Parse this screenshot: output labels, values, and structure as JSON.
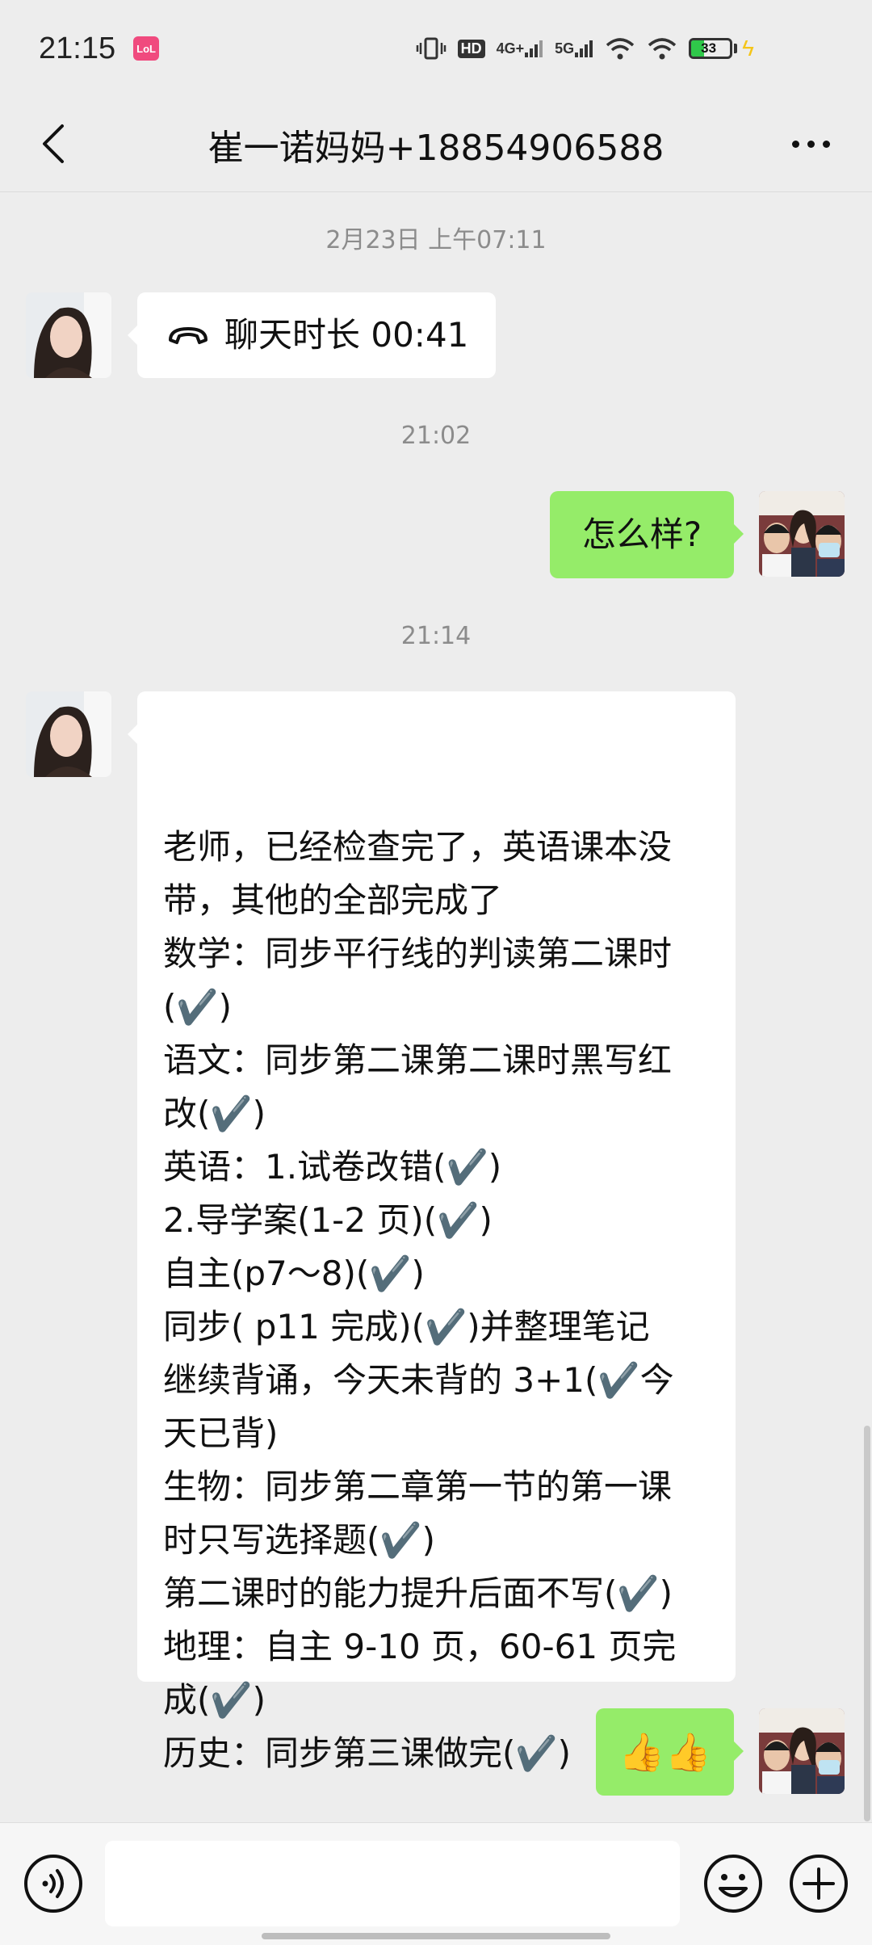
{
  "status_bar": {
    "time": "21:15",
    "app_badge": "LoL",
    "hd_label": "HD",
    "net1_label": "4G+",
    "net2_label": "5G",
    "battery": "33",
    "battery_level": 0.33,
    "icons": [
      "vibrate-icon",
      "hd-icon",
      "signal-4g-icon",
      "signal-5g-icon",
      "wifi-icon",
      "hotspot-icon",
      "battery-icon",
      "charging-icon"
    ]
  },
  "header": {
    "title": "崔一诺妈妈+18854906588",
    "back_icon": "chevron-left-icon",
    "more_icon": "more-dots-icon"
  },
  "messages": [
    {
      "type": "timestamp",
      "text": "2月23日 上午07:11"
    },
    {
      "type": "call",
      "side": "left",
      "text": "聊天时长 00:41",
      "icon": "phone-hangup-icon"
    },
    {
      "type": "timestamp",
      "text": "21:02"
    },
    {
      "type": "text",
      "side": "right",
      "text": "怎么样?"
    },
    {
      "type": "timestamp",
      "text": "21:14"
    },
    {
      "type": "text",
      "side": "left",
      "text": "老师，已经检查完了，英语课本没\n带，其他的全部完成了\n数学：同步平行线的判读第二课时\n(✔️)\n语文：同步第二课第二课时黑写红\n改(✔️)\n英语：1.试卷改错(✔️)\n2.导学案(1-2 页)(✔️)\n自主(p7～8)(✔️)\n同步( p11 完成)(✔️)并整理笔记\n继续背诵，今天未背的 3+1(✔️今\n天已背)\n生物：同步第二章第一节的第一课\n时只写选择题(✔️)\n第二课时的能力提升后面不写(✔️)\n地理：自主 9-10 页，60-61 页完\n成(✔️)\n历史：同步第三课做完(✔️)"
    },
    {
      "type": "emoji",
      "side": "right",
      "text": "👍👍"
    }
  ],
  "colors": {
    "background": "#ededed",
    "bubble_mine": "#95ec69",
    "bubble_theirs": "#ffffff"
  },
  "input_bar": {
    "voice_icon": "voice-icon",
    "emoji_icon": "emoji-icon",
    "plus_icon": "plus-icon"
  }
}
